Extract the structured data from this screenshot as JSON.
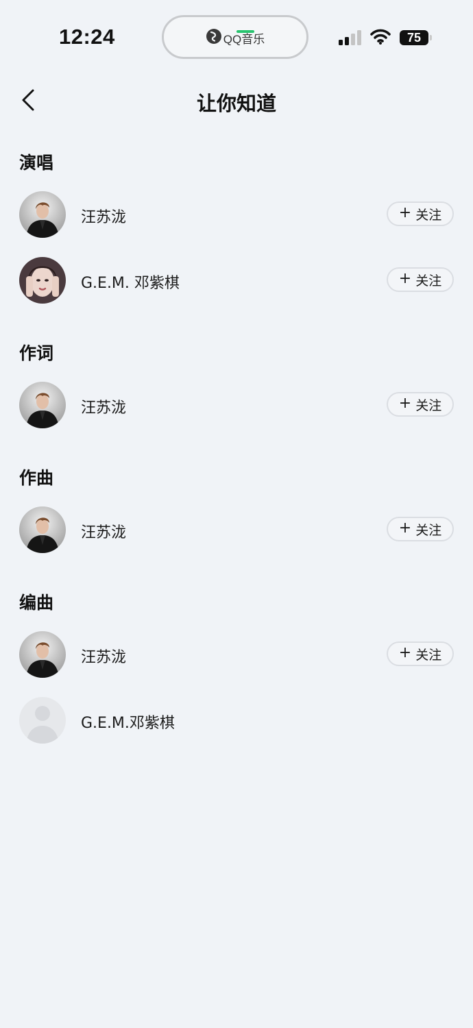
{
  "status_bar": {
    "time": "12:24",
    "island_app_label": "QQ音乐",
    "battery_level": "75",
    "signal_bars_active": 2,
    "signal_bars_total": 4
  },
  "nav": {
    "title": "让你知道"
  },
  "sections": [
    {
      "heading": "演唱",
      "people": [
        {
          "name": "汪苏泷",
          "follow_label": "关注",
          "avatar": "male-photo"
        },
        {
          "name": "G.E.M. 邓紫棋",
          "follow_label": "关注",
          "avatar": "female-photo"
        }
      ]
    },
    {
      "heading": "作词",
      "people": [
        {
          "name": "汪苏泷",
          "follow_label": "关注",
          "avatar": "male-photo"
        }
      ]
    },
    {
      "heading": "作曲",
      "people": [
        {
          "name": "汪苏泷",
          "follow_label": "关注",
          "avatar": "male-photo"
        }
      ]
    },
    {
      "heading": "编曲",
      "people": [
        {
          "name": "汪苏泷",
          "follow_label": "关注",
          "avatar": "male-photo"
        },
        {
          "name": "G.E.M.邓紫棋",
          "follow_label": "",
          "avatar": "default-avatar"
        }
      ]
    }
  ],
  "colors": {
    "background": "#f0f3f7",
    "island_indicator": "#29c46f"
  }
}
